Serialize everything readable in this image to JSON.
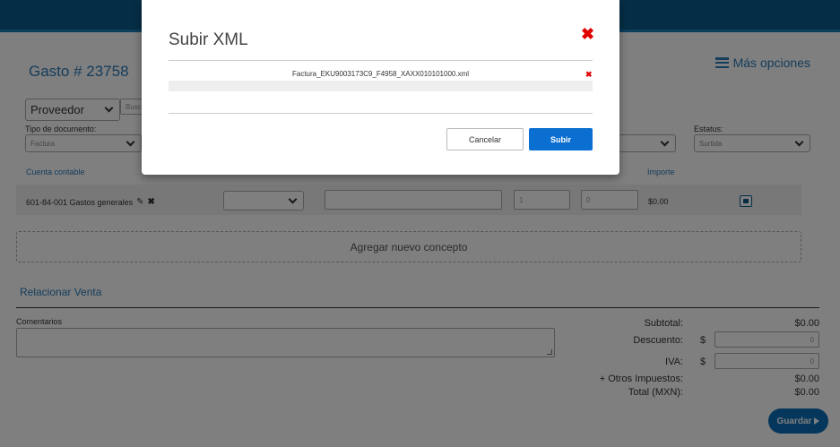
{
  "page": {
    "title": "Gasto # 23758",
    "more_options": "Más opciones",
    "provider_select": "Proveedor",
    "search_placeholder": "Busc",
    "doc_type_label": "Tipo de documento:",
    "doc_type_value": "Factura",
    "status_label": "Estatus:",
    "status_value": "Surtida",
    "cuenta_contable_label": "Cuenta contable",
    "importe_label": "Importe",
    "concept": {
      "account": "601-84-001 Gastos generales",
      "qty": "1",
      "discount": "0",
      "amount": "$0.00"
    },
    "add_concept": "Agregar nuevo concepto",
    "relate_sale": "Relacionar Venta",
    "comments_label": "Comentarios",
    "totals": {
      "subtotal_label": "Subtotal:",
      "subtotal_value": "$0.00",
      "discount_label": "Descuento:",
      "discount_value": "0",
      "iva_label": "IVA:",
      "iva_value": "0",
      "currency_symbol": "$",
      "other_taxes_label": "+ Otros Impuestos:",
      "other_taxes_value": "$0.00",
      "total_label": "Total (MXN):",
      "total_value": "$0.00"
    },
    "save_button": "Guardar"
  },
  "modal": {
    "title": "Subir XML",
    "file_name": "Factura_EKU9003173C9_F4958_XAXX010101000.xml",
    "cancel_button": "Cancelar",
    "upload_button": "Subir"
  },
  "colors": {
    "header": "#0a5d8c",
    "accent_blue": "#2a7ab8",
    "primary_button": "#0a6fd0",
    "close_red": "#e00000"
  }
}
